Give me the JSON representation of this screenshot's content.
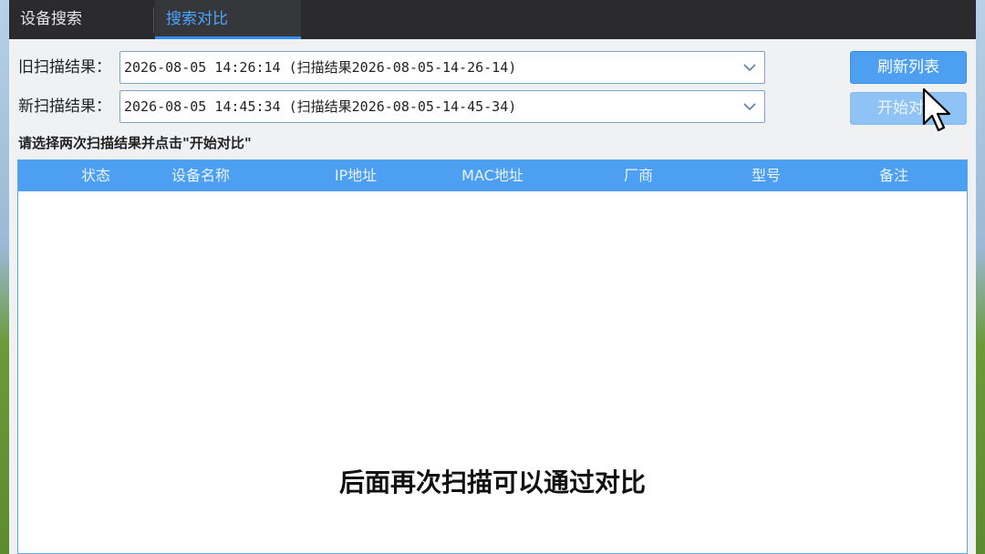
{
  "tabs": [
    {
      "label": "设备搜索",
      "active": false
    },
    {
      "label": "搜索对比",
      "active": true
    }
  ],
  "old_scan": {
    "label": "旧扫描结果：",
    "value": "2026-08-05 14:26:14 (扫描结果2026-08-05-14-26-14)"
  },
  "new_scan": {
    "label": "新扫描结果：",
    "value": "2026-08-05 14:45:34 (扫描结果2026-08-05-14-45-34)"
  },
  "buttons": {
    "refresh": "刷新列表",
    "start_compare": "开始对比"
  },
  "hint": "请选择两次扫描结果并点击\"开始对比\"",
  "table": {
    "columns": [
      "状态",
      "设备名称",
      "IP地址",
      "MAC地址",
      "厂商",
      "型号",
      "备注"
    ],
    "rows": []
  },
  "caption": "后面再次扫描可以通过对比",
  "colors": {
    "accent": "#4d9ff2",
    "tab_active": "#2f8fff",
    "tabbar_bg": "#2b2b2d"
  }
}
